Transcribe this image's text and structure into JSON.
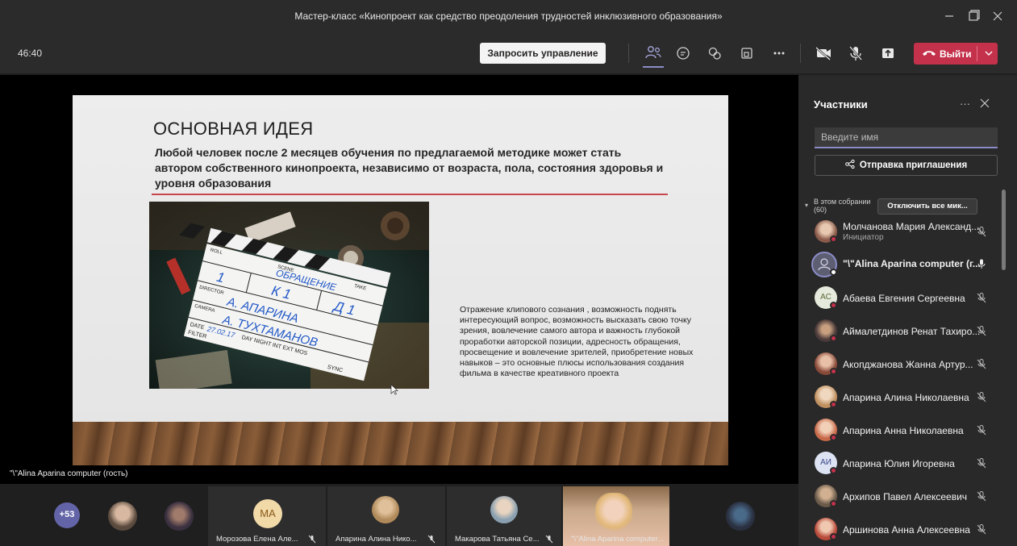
{
  "window": {
    "title": "Мастер-класс «Кинопроект как средство преодоления трудностей инклюзивного образования»"
  },
  "toolbar": {
    "timer": "46:40",
    "request_control_label": "Запросить управление",
    "leave_label": "Выйти"
  },
  "slide": {
    "title": "ОСНОВНАЯ ИДЕЯ",
    "lead": "Любой человек после 2 месяцев обучения по предлагаемой методике может стать автором собственного кинопроекта, независимо от возраста, пола, состояния здоровья и уровня образования",
    "body": "Отражение клипового сознания , возможность поднять интересующий вопрос, возможность высказать свою точку зрения, вовлечение самого автора и важность глубокой проработки авторской позиции, адресность обращения, просвещение и вовлечение зрителей, приобретение новых навыков – это основные плюсы использования создания фильма в качестве креативного проекта",
    "clapper": {
      "scene": "ОБРАЩЕНИЕ",
      "roll": "1",
      "scene_no": "К 1",
      "take": "Д 1",
      "director": "А. АПАРИНА",
      "camera": "А. ТУХТАМАНОВ",
      "date": "27.02.17",
      "director_label": "DIRECTOR",
      "camera_label": "CAMERA",
      "date_label": "DATE",
      "filter_label": "FILTER",
      "options": "DAY NIGHT INT EXT MOS",
      "sync": "SYNC",
      "roll_label": "ROLL",
      "scene_label": "SCENE",
      "take_label": "TAKE"
    }
  },
  "presenter_label": "\"\\\"Alina Aparina computer (гость)",
  "bottom_strip": {
    "overflow_count": "+53",
    "initials_tile": "МА",
    "tiles": [
      {
        "name": "Морозова Елена Але..."
      },
      {
        "name": "Апарина Алина Нико..."
      },
      {
        "name": "Макарова Татьяна Се..."
      },
      {
        "name": "\"\\\"Alina Aparina computer..."
      }
    ]
  },
  "panel": {
    "title": "Участники",
    "more": "···",
    "search_placeholder": "Введите имя",
    "invite_label": "Отправка приглашения",
    "section_label": "В этом собрании (60)",
    "mute_all_label": "Отключить все мик...",
    "participants": [
      {
        "name": "Молчанова Мария Александ...",
        "role": "Инициатор",
        "initials": "",
        "avatar_color": "#9a6a5a"
      },
      {
        "name": "\"\\\"Alina Aparina computer (г...",
        "role": "",
        "initials": "",
        "avatar_color": "#6d6d8a"
      },
      {
        "name": "Абаева Евгения Сергеевна",
        "role": "",
        "initials": "АС",
        "avatar_color": "#e8ece0"
      },
      {
        "name": "Аймалетдинов Ренат Тахиро...",
        "role": "",
        "initials": "",
        "avatar_color": "#7a6a5a"
      },
      {
        "name": "Акопджанова Жанна Артур...",
        "role": "",
        "initials": "",
        "avatar_color": "#a86a5a"
      },
      {
        "name": "Апарина Алина Николаевна",
        "role": "",
        "initials": "",
        "avatar_color": "#c9a07a"
      },
      {
        "name": "Апарина Анна Николаевна",
        "role": "",
        "initials": "",
        "avatar_color": "#d18a6a"
      },
      {
        "name": "Апарина Юлия Игоревна",
        "role": "",
        "initials": "АИ",
        "avatar_color": "#dfe4f2"
      },
      {
        "name": "Архипов Павел Алексеевич",
        "role": "",
        "initials": "",
        "avatar_color": "#8a7a6a"
      },
      {
        "name": "Аршинова Анна Алексеевна",
        "role": "",
        "initials": "",
        "avatar_color": "#b85a4a"
      }
    ]
  },
  "colors": {
    "accent": "#8b8cc7",
    "leave_red": "#c4314b",
    "slide_rule": "#c8474d"
  }
}
